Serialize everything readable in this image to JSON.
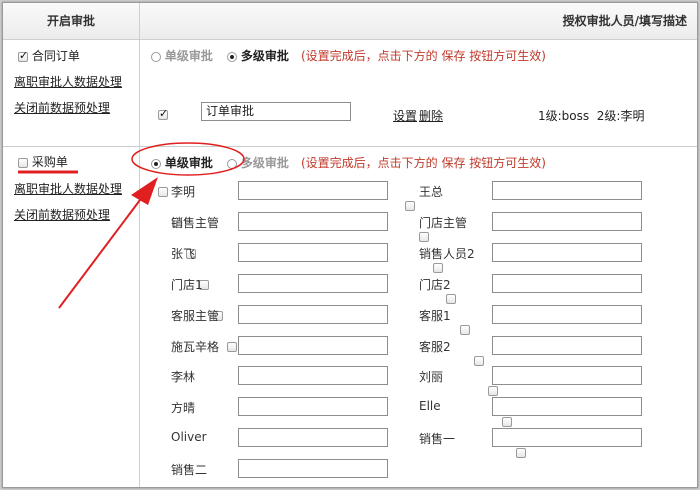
{
  "header": {
    "left_title": "开启审批",
    "right_title": "授权审批人员/填写描述"
  },
  "contract": {
    "checkbox_label": "合同订单",
    "links": [
      "离职审批人数据处理",
      "关闭前数据预处理"
    ],
    "single_level_label": "单级审批",
    "multi_level_label": "多级审批",
    "note": "(设置完成后，点击下方的 保存 按钮方可生效)",
    "approval_name": "订单审批",
    "settings_label": "设置",
    "delete_label": "删除",
    "levels_text": "1级:boss  2级:李明"
  },
  "purchase": {
    "checkbox_label": "采购单",
    "links": [
      "离职审批人数据处理",
      "关闭前数据预处理"
    ],
    "single_level_label": "单级审批",
    "multi_level_label": "多级审批",
    "note": "(设置完成后，点击下方的 保存 按钮方可生效)"
  },
  "people_left": [
    "李明",
    "销售主管",
    "张飞",
    "门店1",
    "客服主管",
    "施瓦辛格",
    "李林",
    "方晴",
    "Oliver",
    "销售二"
  ],
  "people_right": [
    "王总",
    "门店主管",
    "销售人员2",
    "门店2",
    "客服1",
    "客服2",
    "刘丽",
    "Elle",
    "销售一"
  ],
  "annotation_color": "#e02020"
}
